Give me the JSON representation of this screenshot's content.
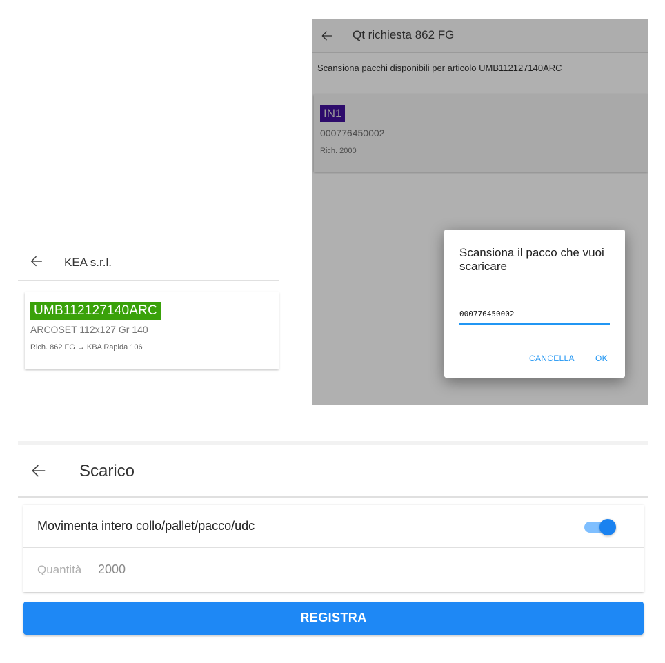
{
  "screen_kea": {
    "title": "KEA s.r.l.",
    "back_icon": "arrow-left-icon",
    "card": {
      "code": "UMB112127140ARC",
      "code_color": "#3aa10a",
      "description": "ARCOSET 112x127 Gr 140",
      "request": "Rich. 862 FG → KBA Rapida 106"
    }
  },
  "screen_request": {
    "title": "Qt richiesta 862 FG",
    "back_icon": "arrow-left-icon",
    "subtitle": "Scansiona pacchi disponibili per articolo UMB112127140ARC",
    "card": {
      "code": "IN1",
      "code_color": "#2d0b6b",
      "number": "000776450002",
      "request": "Rich. 2000"
    },
    "dialog": {
      "title": "Scansiona il pacco che vuoi scaricare",
      "input_value": "000776450002",
      "cancel_label": "CANCELLA",
      "ok_label": "OK"
    }
  },
  "screen_scarico": {
    "title": "Scarico",
    "back_icon": "arrow-left-icon",
    "toggle_label": "Movimenta intero collo/pallet/pacco/udc",
    "toggle_on": true,
    "quantity_label": "Quantità",
    "quantity_value": "2000",
    "submit_label": "REGISTRA",
    "accent_color": "#1e88f5"
  }
}
